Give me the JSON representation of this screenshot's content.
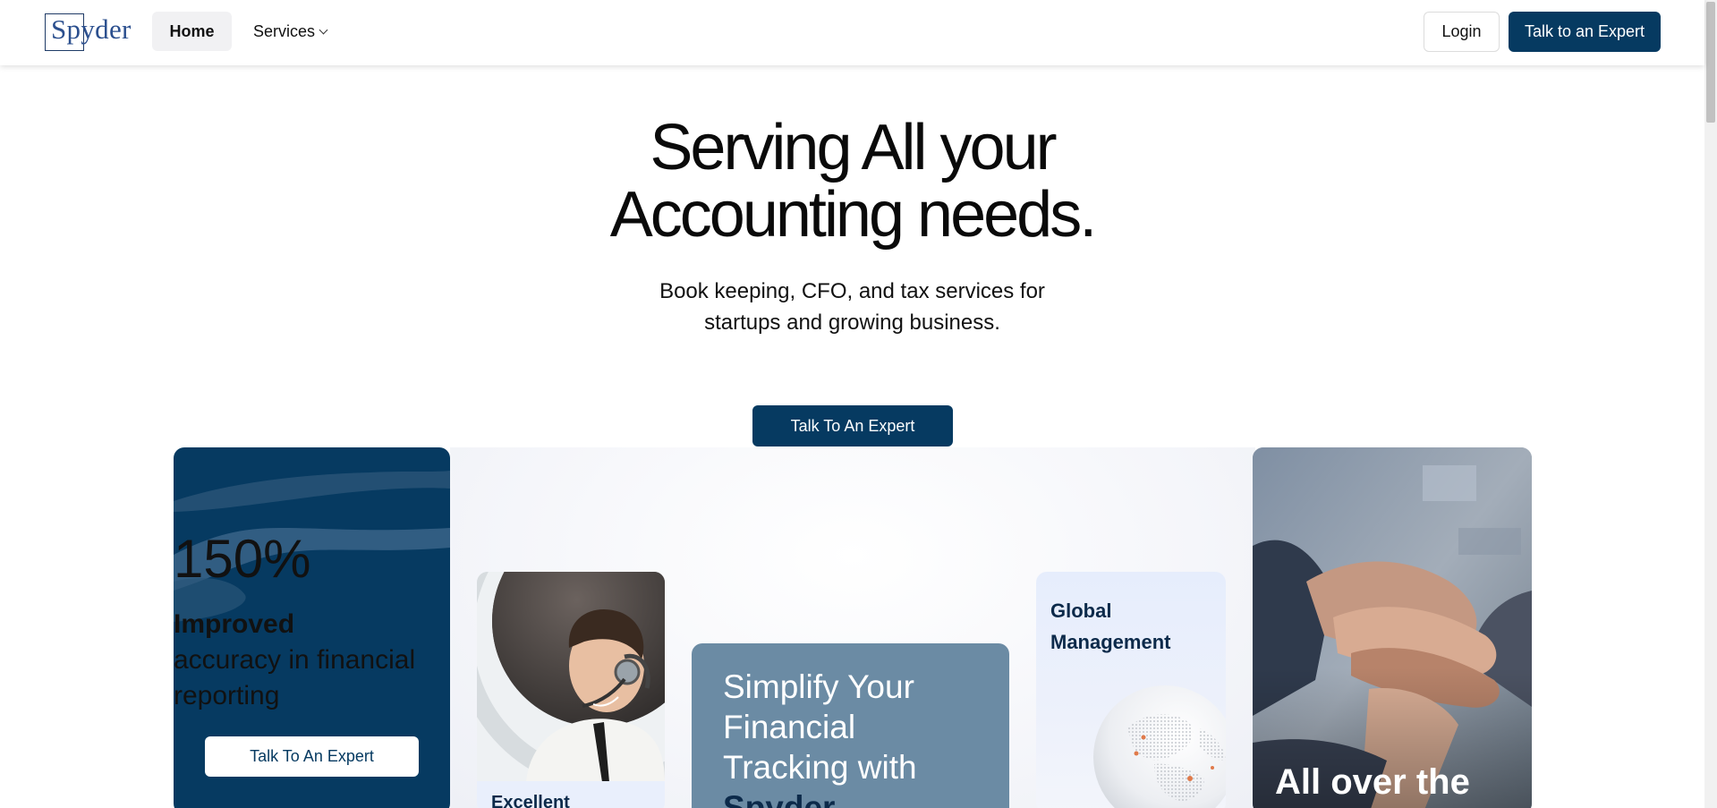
{
  "nav": {
    "logo_text": "Spyder",
    "home_label": "Home",
    "services_label": "Services",
    "login_label": "Login",
    "cta_label": "Talk to an Expert"
  },
  "hero": {
    "title_line1": "Serving All your",
    "title_line2": "Accounting needs.",
    "subtitle_line1": "Book keeping, CFO, and tax services for",
    "subtitle_line2": "startups and growing business.",
    "cta_label": "Talk To An Expert"
  },
  "cards": {
    "stat": {
      "value": "150%",
      "label_bold": "Improved",
      "label_line2": "accuracy in financial",
      "label_line3": "reporting",
      "button_label": "Talk To An Expert"
    },
    "support": {
      "label": "Excellent"
    },
    "simplify": {
      "line1": "Simplify Your",
      "line2": "Financial",
      "line3": "Tracking with",
      "brand": "Spyder"
    },
    "global": {
      "line1": "Global",
      "line2": "Management"
    },
    "hands": {
      "label": "All over the"
    }
  },
  "colors": {
    "primary": "#063a61",
    "simplify_card": "#6b8ba4",
    "light_card": "#e9effc"
  },
  "icons": [
    "chevron-down-icon"
  ]
}
